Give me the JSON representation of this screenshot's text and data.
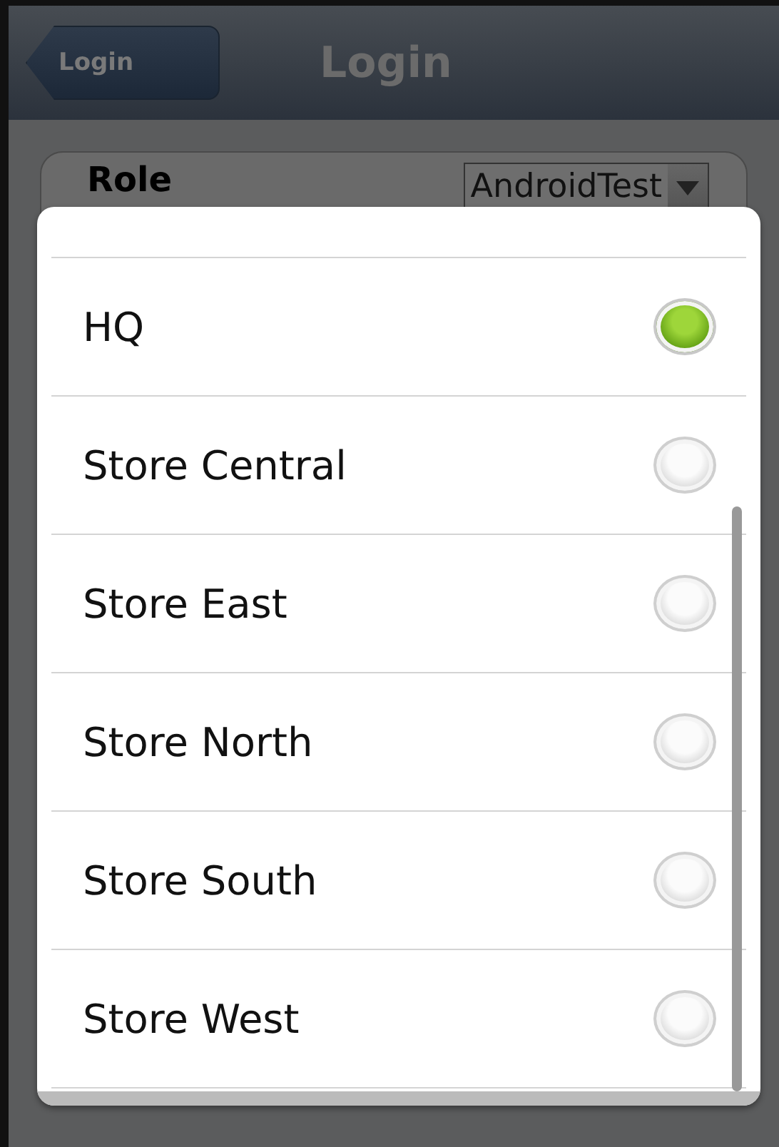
{
  "header": {
    "back_button": "Login",
    "title": "Login"
  },
  "form": {
    "label": "Role",
    "select_value": "AndroidTest"
  },
  "dialog": {
    "options": [
      {
        "label": "HQ",
        "selected": true
      },
      {
        "label": "Store Central",
        "selected": false
      },
      {
        "label": "Store East",
        "selected": false
      },
      {
        "label": "Store North",
        "selected": false
      },
      {
        "label": "Store South",
        "selected": false
      },
      {
        "label": "Store West",
        "selected": false
      }
    ]
  }
}
